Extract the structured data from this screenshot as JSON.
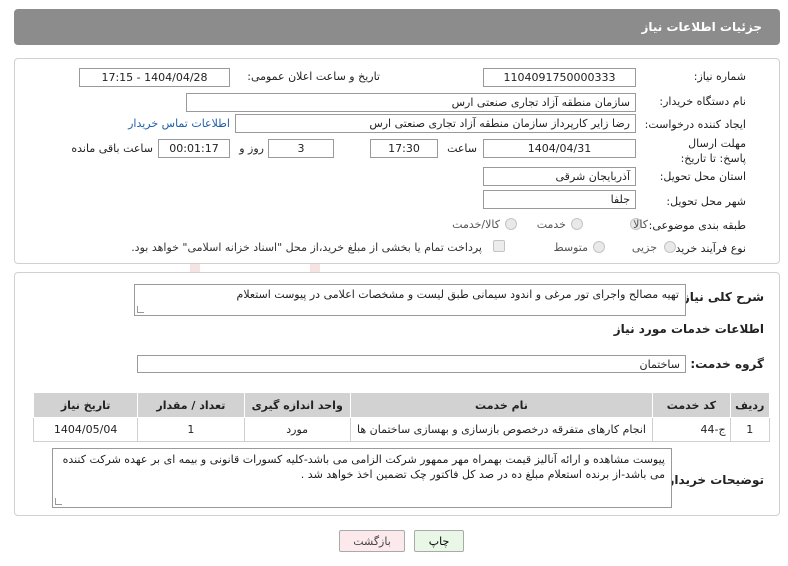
{
  "header": {
    "title": "جزئیات اطلاعات نیاز"
  },
  "form": {
    "need_number_label": "شماره نیاز:",
    "need_number": "1104091750000333",
    "public_date_label": "تاریخ و ساعت اعلان عمومی:",
    "public_date": "1404/04/28 - 17:15",
    "buyer_org_label": "نام دستگاه خریدار:",
    "buyer_org": "سازمان منطقه آزاد تجاری صنعتی ارس",
    "creator_label": "ایجاد کننده درخواست:",
    "creator": "رضا زایر کارپرداز سازمان منطقه آزاد تجاری صنعتی ارس",
    "buyer_contact_link": "اطلاعات تماس خریدار",
    "deadline_label": "مهلت ارسال پاسخ: تا تاریخ:",
    "deadline_date": "1404/04/31",
    "time_label": "ساعت",
    "deadline_time": "17:30",
    "days_value": "3",
    "days_label": "روز و",
    "remaining_time": "00:01:17",
    "remaining_label": "ساعت باقی مانده",
    "province_label": "استان محل تحویل:",
    "province": "آذربایجان شرقی",
    "city_label": "شهر محل تحویل:",
    "city": "جلفا",
    "category_label": "طبقه بندی موضوعی:",
    "category_options": [
      "کالا",
      "خدمت",
      "کالا/خدمت"
    ],
    "purchase_type_label": "نوع فرآیند خرید :",
    "purchase_options": [
      "جزیی",
      "متوسط"
    ],
    "payment_note": "پرداخت تمام یا بخشی از مبلغ خرید،از محل \"اسناد خزانه اسلامی\" خواهد بود."
  },
  "details": {
    "summary_label": "شرح کلی نیاز:",
    "summary": "تهیه مصالح واجرای تور مرغی و اندود سیمانی طبق لیست و مشخصات اعلامی در پیوست استعلام",
    "services_title": "اطلاعات خدمات مورد نیاز",
    "service_group_label": "گروه خدمت:",
    "service_group": "ساختمان",
    "table": {
      "headers": [
        "ردیف",
        "کد خدمت",
        "نام خدمت",
        "واحد اندازه گیری",
        "تعداد / مقدار",
        "تاریخ نیاز"
      ],
      "rows": [
        [
          "1",
          "ج-44",
          "انجام کارهای متفرقه درخصوص بازسازی و بهسازی ساختمان ها",
          "مورد",
          "1",
          "1404/05/04"
        ]
      ]
    },
    "buyer_notes_label": "توضیحات خریدار:",
    "buyer_notes": "پیوست مشاهده و ارائه آنالیز قیمت بهمراه مهر ممهور شرکت الزامی می باشد-کلیه کسورات قانونی و بیمه ای بر عهده شرکت کننده می باشد-از برنده استعلام مبلغ ده در صد کل فاکتور چک تضمین اخذ خواهد شد ."
  },
  "buttons": {
    "print": "چاپ",
    "back": "بازگشت"
  },
  "watermark": {
    "brand": "AriaTender.neT"
  },
  "colors": {
    "header_bg": "#8c8c8c",
    "link": "#1f5fa8",
    "print_bg": "#e9f7e6",
    "back_bg": "#fbe9ec",
    "watermark": "#c0392b"
  }
}
